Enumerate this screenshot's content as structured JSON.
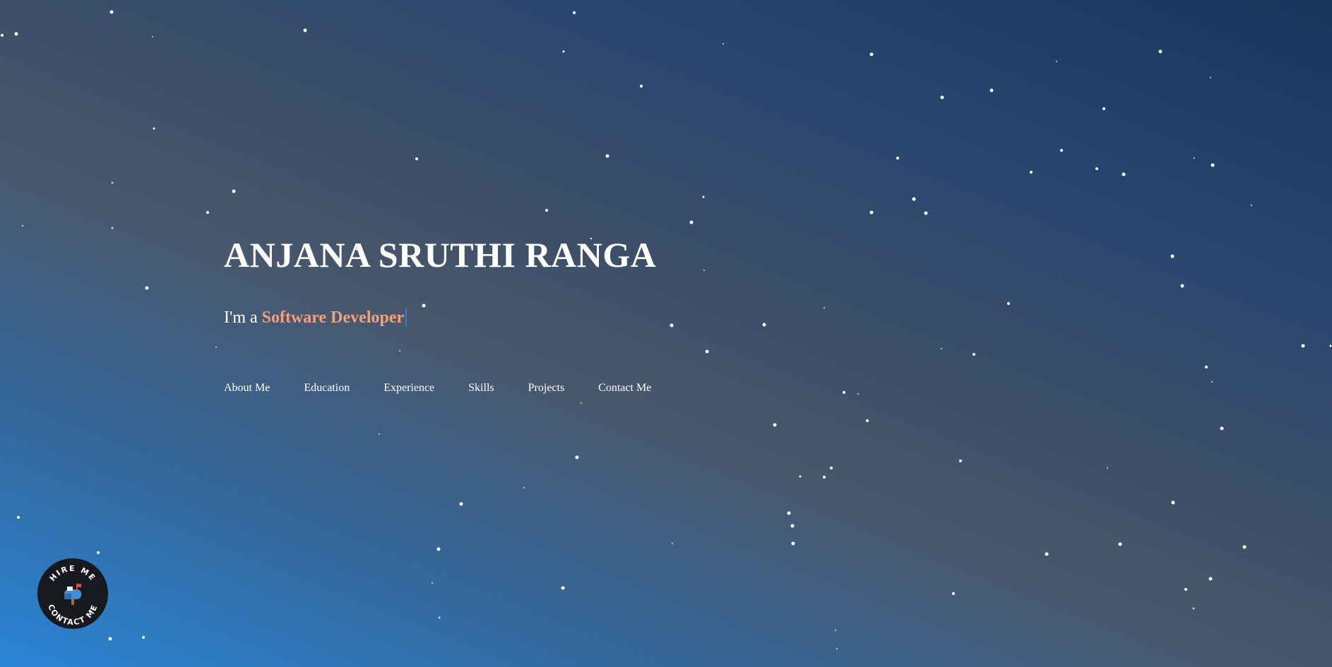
{
  "hero": {
    "name": "ANJANA SRUTHI RANGA",
    "tagline_prefix": "I'm a",
    "tagline_role": "Software Developer"
  },
  "nav": {
    "items": [
      {
        "label": "About Me"
      },
      {
        "label": "Education"
      },
      {
        "label": "Experience"
      },
      {
        "label": "Skills"
      },
      {
        "label": "Projects"
      },
      {
        "label": "Contact Me"
      }
    ]
  },
  "hire_badge": {
    "top_text": "HIRE ME",
    "bottom_text": "CONTACT ME",
    "icon": "mailbox-icon"
  },
  "colors": {
    "accent": "#f4a07c",
    "cursor": "#2f7bd8",
    "badge_bg": "#16191d"
  }
}
